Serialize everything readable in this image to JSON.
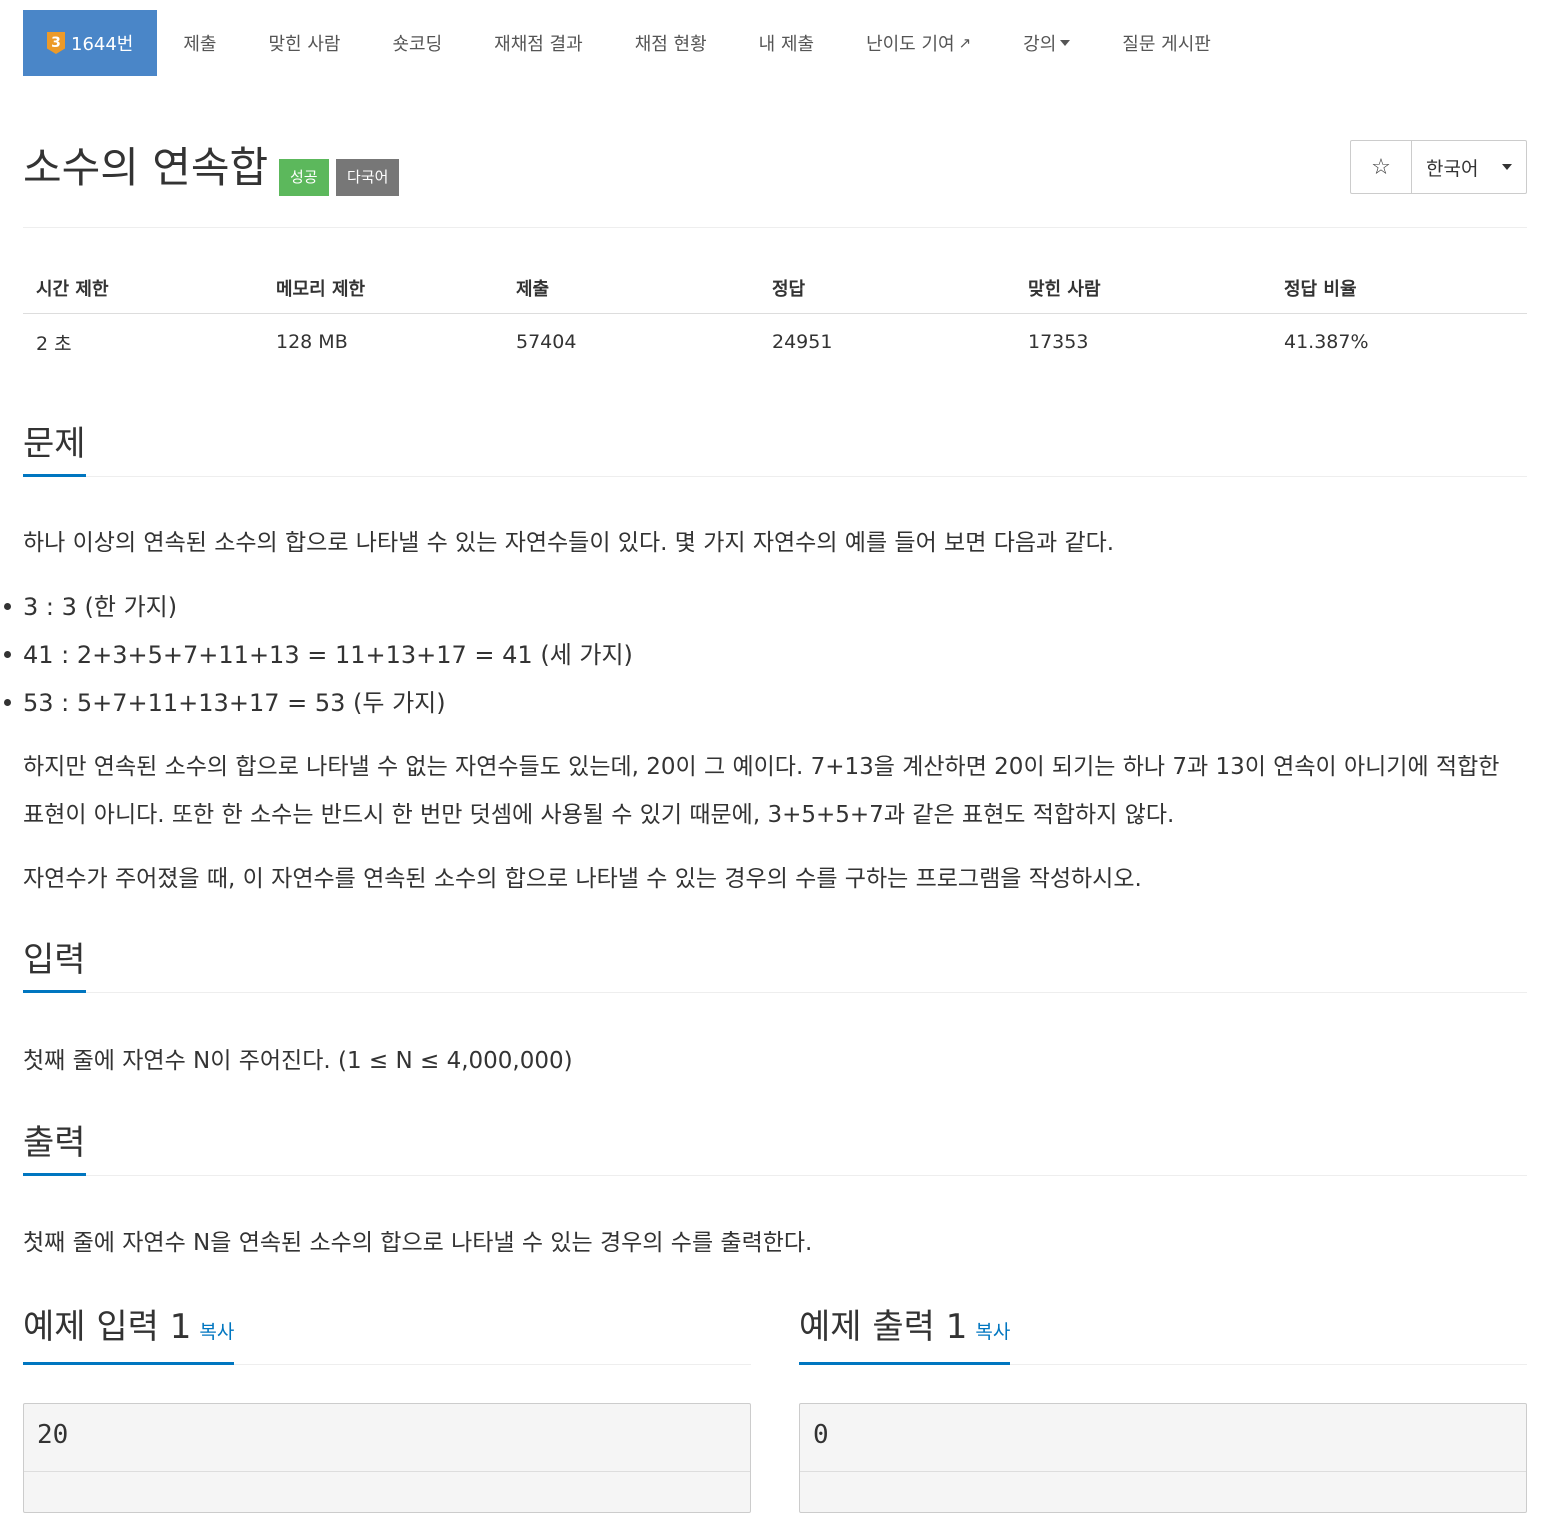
{
  "nav": {
    "problem_tier": "3",
    "problem_id": "1644번",
    "items": [
      "제출",
      "맞힌 사람",
      "숏코딩",
      "재채점 결과",
      "채점 현황",
      "내 제출",
      "난이도 기여",
      "강의",
      "질문 게시판"
    ]
  },
  "title": {
    "text": "소수의 연속합",
    "label_success": "성공",
    "label_multilang": "다국어",
    "star": "☆",
    "language": "한국어"
  },
  "stats": {
    "headers": [
      "시간 제한",
      "메모리 제한",
      "제출",
      "정답",
      "맞힌 사람",
      "정답 비율"
    ],
    "values": [
      "2 초",
      "128 MB",
      "57404",
      "24951",
      "17353",
      "41.387%"
    ]
  },
  "problem": {
    "heading": "문제",
    "intro": "하나 이상의 연속된 소수의 합으로 나타낼 수 있는 자연수들이 있다. 몇 가지 자연수의 예를 들어 보면 다음과 같다.",
    "examples": [
      "3 : 3 (한 가지)",
      "41 : 2+3+5+7+11+13 = 11+13+17 = 41 (세 가지)",
      "53 : 5+7+11+13+17 = 53 (두 가지)"
    ],
    "para2": "하지만 연속된 소수의 합으로 나타낼 수 없는 자연수들도 있는데, 20이 그 예이다. 7+13을 계산하면 20이 되기는 하나 7과 13이 연속이 아니기에 적합한 표현이 아니다. 또한 한 소수는 반드시 한 번만 덧셈에 사용될 수 있기 때문에, 3+5+5+7과 같은 표현도 적합하지 않다.",
    "para3": "자연수가 주어졌을 때, 이 자연수를 연속된 소수의 합으로 나타낼 수 있는 경우의 수를 구하는 프로그램을 작성하시오."
  },
  "input": {
    "heading": "입력",
    "text": "첫째 줄에 자연수 N이 주어진다. (1 ≤ N ≤ 4,000,000)"
  },
  "output": {
    "heading": "출력",
    "text": "첫째 줄에 자연수 N을 연속된 소수의 합으로 나타낼 수 있는 경우의 수를 출력한다."
  },
  "sample_input": {
    "heading": "예제 입력 1",
    "copy": "복사",
    "value": "20"
  },
  "sample_output": {
    "heading": "예제 출력 1",
    "copy": "복사",
    "value": "0"
  },
  "colors": {
    "nav_active": "#4a86c8",
    "success": "#5cb85c",
    "multilang": "#777777",
    "link": "#0076c0",
    "tier": "#ec9a29"
  }
}
